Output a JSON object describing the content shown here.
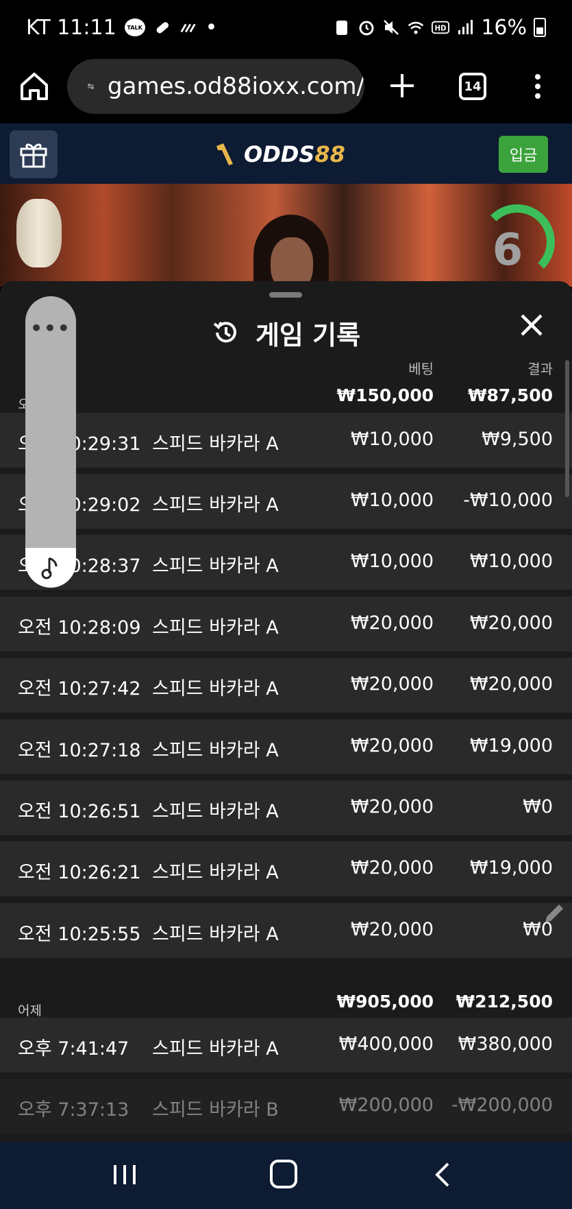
{
  "status_bar": {
    "carrier_time": "KT 11:11",
    "talk_badge": "TALK",
    "dot": "•",
    "battery": "16%"
  },
  "browser": {
    "url": "games.od88ioxx.com/",
    "tab_count": "14"
  },
  "site": {
    "logo_part1": "ODDS",
    "logo_part2": "88",
    "deposit_label": "입금"
  },
  "video": {
    "timer": "6"
  },
  "history": {
    "title": "게임 기록",
    "col_bet": "베팅",
    "col_result": "결과",
    "today": {
      "label": "오",
      "bet_total": "₩150,000",
      "result_total": "₩87,500"
    },
    "today_rows": [
      {
        "time": "오전 10:29:31",
        "game": "스피드 바카라 A",
        "bet": "₩10,000",
        "result": "₩9,500"
      },
      {
        "time": "오전 10:29:02",
        "game": "스피드 바카라 A",
        "bet": "₩10,000",
        "result": "-₩10,000"
      },
      {
        "time": "오전 10:28:37",
        "game": "스피드 바카라 A",
        "bet": "₩10,000",
        "result": "₩10,000"
      },
      {
        "time": "오전 10:28:09",
        "game": "스피드 바카라 A",
        "bet": "₩20,000",
        "result": "₩20,000"
      },
      {
        "time": "오전 10:27:42",
        "game": "스피드 바카라 A",
        "bet": "₩20,000",
        "result": "₩20,000"
      },
      {
        "time": "오전 10:27:18",
        "game": "스피드 바카라 A",
        "bet": "₩20,000",
        "result": "₩19,000"
      },
      {
        "time": "오전 10:26:51",
        "game": "스피드 바카라 A",
        "bet": "₩20,000",
        "result": "₩0"
      },
      {
        "time": "오전 10:26:21",
        "game": "스피드 바카라 A",
        "bet": "₩20,000",
        "result": "₩19,000"
      },
      {
        "time": "오전 10:25:55",
        "game": "스피드 바카라 A",
        "bet": "₩20,000",
        "result": "₩0"
      }
    ],
    "yesterday": {
      "label": "어제",
      "bet_total": "₩905,000",
      "result_total": "₩212,500"
    },
    "yesterday_rows": [
      {
        "time": "오후 7:41:47",
        "game": "스피드 바카라 A",
        "bet": "₩400,000",
        "result": "₩380,000"
      },
      {
        "time": "오후 7:37:13",
        "game": "스피드 바카라 B",
        "bet": "₩200,000",
        "result": "-₩200,000"
      }
    ]
  },
  "floater": {
    "menu": "•••"
  },
  "colors": {
    "header_bg": "#0d1b33",
    "panel_bg": "#1b1b1b",
    "row_bg": "#2a2a2a",
    "deposit_green": "#3ba33c",
    "logo_gold": "#e8b64a"
  }
}
